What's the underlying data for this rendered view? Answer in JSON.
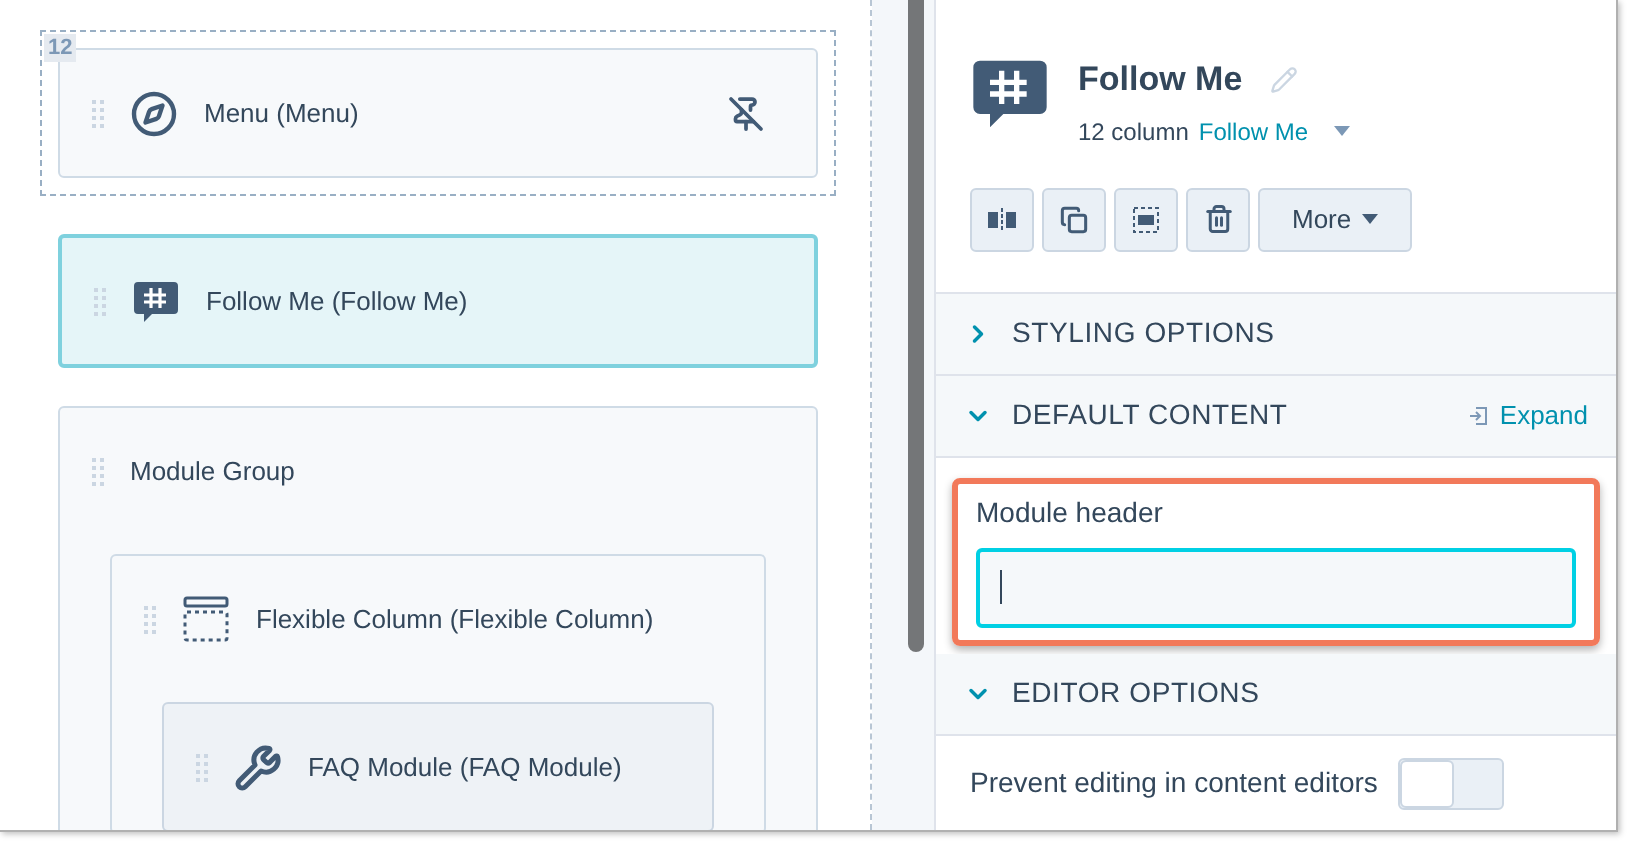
{
  "canvas": {
    "modules": [
      {
        "label": "Menu (Menu)",
        "badge": "12",
        "selected": false,
        "pinned": true
      },
      {
        "label": "Follow Me (Follow Me)",
        "selected": true
      },
      {
        "label": "Module Group",
        "selected": false,
        "children": [
          {
            "label": "Flexible Column (Flexible Column)",
            "selected": false,
            "children": [
              {
                "label": "FAQ Module (FAQ Module)",
                "selected": false
              }
            ]
          }
        ]
      }
    ]
  },
  "panel": {
    "title": "Follow Me",
    "subtitle": "12 column",
    "type_link": "Follow Me",
    "more_button": "More",
    "sections": [
      {
        "kind": "section",
        "title": "STYLING OPTIONS",
        "expanded": false
      },
      {
        "kind": "section",
        "title": "DEFAULT CONTENT",
        "expanded": true,
        "action": "Expand",
        "fields": [
          {
            "label": "Module header",
            "focused": true,
            "highlighted": true
          }
        ]
      },
      {
        "kind": "section",
        "title": "EDITOR OPTIONS",
        "expanded": true,
        "toggles": [
          {
            "label": "Prevent editing in content editors",
            "on": false
          }
        ]
      }
    ]
  }
}
